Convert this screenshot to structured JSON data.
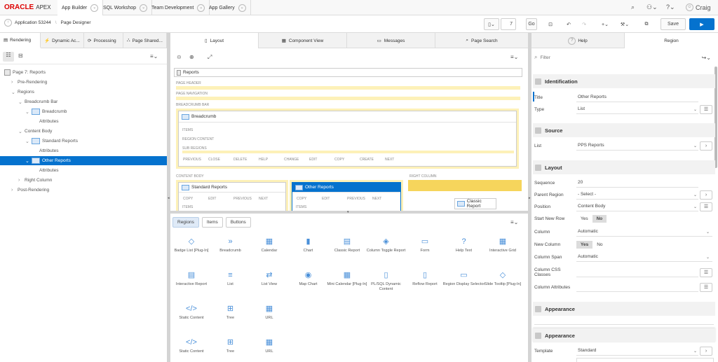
{
  "top": {
    "logo": "ORACLE",
    "apex": "APEX",
    "nav": [
      "App Builder",
      "SQL Workshop",
      "Team Development",
      "App Gallery"
    ],
    "user": "Craig"
  },
  "sub": {
    "app": "Application 53244",
    "page_designer": "Page Designer",
    "page_num": "7",
    "go": "Go",
    "save": "Save"
  },
  "left": {
    "tabs": [
      "Rendering",
      "Dynamic Ac...",
      "Processing",
      "Page Shared..."
    ],
    "tree": [
      {
        "label": "Page 7: Reports",
        "indent": 0,
        "icon": "page"
      },
      {
        "label": "Pre-Rendering",
        "indent": 1,
        "arrow": ">"
      },
      {
        "label": "Regions",
        "indent": 1,
        "arrow": "v"
      },
      {
        "label": "Breadcrumb Bar",
        "indent": 2,
        "arrow": "v"
      },
      {
        "label": "Breadcrumb",
        "indent": 3,
        "arrow": "v",
        "icon": "reg"
      },
      {
        "label": "Attributes",
        "indent": 5
      },
      {
        "label": "Content Body",
        "indent": 2,
        "arrow": "v"
      },
      {
        "label": "Standard Reports",
        "indent": 3,
        "arrow": "v",
        "icon": "reg"
      },
      {
        "label": "Attributes",
        "indent": 5
      },
      {
        "label": "Other Reports",
        "indent": 3,
        "arrow": "v",
        "icon": "reg",
        "sel": true
      },
      {
        "label": "Attributes",
        "indent": 5
      },
      {
        "label": "Right Column",
        "indent": 2,
        "arrow": ">"
      },
      {
        "label": "Post-Rendering",
        "indent": 1,
        "arrow": ">"
      }
    ]
  },
  "center": {
    "tabs": [
      "Layout",
      "Component View",
      "Messages",
      "Page Search"
    ],
    "reports_title": "Reports",
    "page_header": "PAGE HEADER",
    "page_navigation": "PAGE NAVIGATION",
    "breadcrumb_bar": "BREADCRUMB BAR",
    "breadcrumb_region": "Breadcrumb",
    "items": "ITEMS",
    "region_content": "REGION CONTENT",
    "sub_regions": "SUB REGIONS",
    "btns": [
      "PREVIOUS",
      "CLOSE",
      "DELETE",
      "HELP",
      "CHANGE",
      "EDIT",
      "COPY",
      "CREATE",
      "NEXT"
    ],
    "content_body": "CONTENT BODY",
    "right_column": "RIGHT COLUMN",
    "standard_reports": "Standard Reports",
    "other_reports": "Other Reports",
    "classic_report": "Classic Report",
    "mini_btns": [
      "COPY",
      "EDIT",
      "PREVIOUS",
      "NEXT"
    ]
  },
  "gallery": {
    "tabs": [
      "Regions",
      "Items",
      "Buttons"
    ],
    "items": [
      {
        "label": "Badge List [Plug-In]",
        "icon": "◇"
      },
      {
        "label": "Breadcrumb",
        "icon": "»"
      },
      {
        "label": "Calendar",
        "icon": "▦"
      },
      {
        "label": "Chart",
        "icon": "▮"
      },
      {
        "label": "Classic Report",
        "icon": "▤"
      },
      {
        "label": "Column Toggle Report",
        "icon": "◈"
      },
      {
        "label": "Form",
        "icon": "▭"
      },
      {
        "label": "Help Text",
        "icon": "?"
      },
      {
        "label": "Interactive Grid",
        "icon": "▦"
      },
      {
        "label": "Interactive Report",
        "icon": "▤"
      },
      {
        "label": "List",
        "icon": "≡"
      },
      {
        "label": "List View",
        "icon": "⇄"
      },
      {
        "label": "Map Chart",
        "icon": "◉"
      },
      {
        "label": "Mini Calendar [Plug-In]",
        "icon": "▦"
      },
      {
        "label": "PL/SQL Dynamic Content",
        "icon": "▯"
      },
      {
        "label": "Reflow Report",
        "icon": "▯"
      },
      {
        "label": "Region Display Selector",
        "icon": "▭"
      },
      {
        "label": "Slide Tooltip [Plug-In]",
        "icon": "◇"
      },
      {
        "label": "Static Content",
        "icon": "</>"
      },
      {
        "label": "Tree",
        "icon": "⊞"
      },
      {
        "label": "URL",
        "icon": "▦"
      },
      {
        "label": "Static Content",
        "icon": "</>"
      },
      {
        "label": "Tree",
        "icon": "⊞"
      },
      {
        "label": "URL",
        "icon": "▦"
      }
    ]
  },
  "right": {
    "help": "Help",
    "region": "Region",
    "filter_placeholder": "Filter",
    "sections": {
      "identification": "Identification",
      "source": "Source",
      "layout": "Layout",
      "appearance": "Appearance",
      "appearance2": "Appearance"
    },
    "title_label": "Title",
    "title_value": "Other Reports",
    "type_label": "Type",
    "type_value": "List",
    "list_label": "List",
    "list_value": "PPS Reports",
    "sequence_label": "Sequence",
    "sequence_value": "20",
    "parent_label": "Parent Region",
    "parent_value": "- Select -",
    "position_label": "Position",
    "position_value": "Content Body",
    "start_row_label": "Start New Row",
    "yes": "Yes",
    "no": "No",
    "column_label": "Column",
    "column_value": "Automatic",
    "new_col_label": "New Column",
    "span_label": "Column Span",
    "span_value": "Automatic",
    "css_label": "Column CSS Classes",
    "attr_label": "Column Attributes",
    "template_label": "Template",
    "template_value": "Standard"
  }
}
